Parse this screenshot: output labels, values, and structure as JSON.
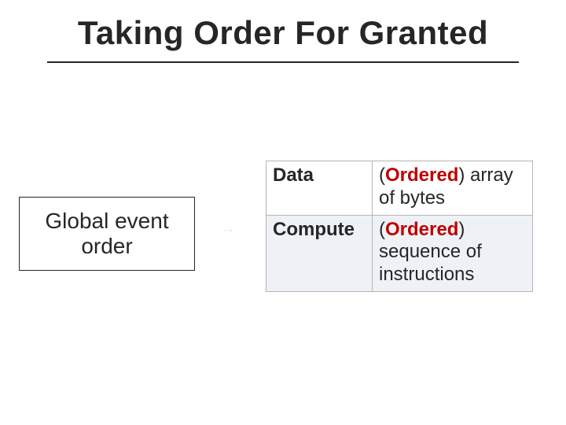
{
  "slide": {
    "title": "Taking Order For Granted"
  },
  "left_box": {
    "line1": "Global event",
    "line2": "order"
  },
  "table": {
    "rows": [
      {
        "label": "Data",
        "ordered": "Ordered",
        "desc": "array of bytes"
      },
      {
        "label": "Compute",
        "ordered": "Ordered",
        "desc": "sequence of instructions"
      }
    ],
    "paren_open": "(",
    "paren_close": ")"
  },
  "colors": {
    "accent_red": "#c00000",
    "arrow": "#5b9bd5"
  }
}
